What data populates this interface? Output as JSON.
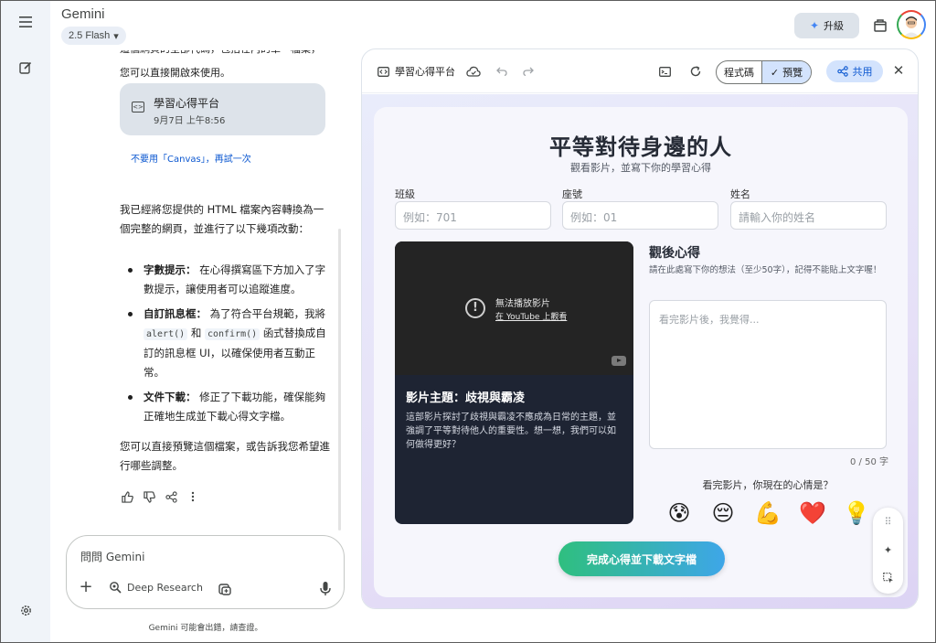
{
  "app": {
    "title": "Gemini",
    "model": "2.5 Flash"
  },
  "header": {
    "upgrade_label": "升級"
  },
  "chat": {
    "intro_lines": [
      "這個網頁的全部代碼，包括在內的單一檔案，",
      "您可以直接開啟來使用。"
    ],
    "file_card": {
      "title": "學習心得平台",
      "date": "9月7日 上午8:56"
    },
    "no_canvas_link": "不要用「Canvas」，再試一次",
    "para1": "我已經將您提供的 HTML 檔案內容轉換為一個完整的網頁，並進行了以下幾項改動：",
    "bullets": [
      {
        "bold": "字數提示：",
        "text": "在心得撰寫區下方加入了字數提示，讓使用者可以追蹤進度。"
      },
      {
        "bold": "自訂訊息框：",
        "pre": "為了符合平台規範，我將",
        "code1": "alert()",
        "mid": "和",
        "code2": "confirm()",
        "post": "函式替換成自訂的訊息框 UI，以確保使用者互動正常。"
      },
      {
        "bold": "文件下載：",
        "text": "修正了下載功能，確保能夠正確地生成並下載心得文字檔。"
      }
    ],
    "para2": "您可以直接預覽這個檔案，或告訴我您希望進行哪些調整。"
  },
  "composer": {
    "placeholder": "問問 Gemini",
    "deep_research": "Deep Research"
  },
  "disclaimer": "Gemini 可能會出錯，請查證。",
  "canvas": {
    "title": "學習心得平台",
    "code_tab": "程式碼",
    "preview_tab": "預覽",
    "share_label": "共用",
    "page": {
      "title": "平等對待身邊的人",
      "subtitle": "觀看影片，並寫下你的學習心得",
      "fields": [
        {
          "label": "班級",
          "placeholder": "例如：701"
        },
        {
          "label": "座號",
          "placeholder": "例如：01"
        },
        {
          "label": "姓名",
          "placeholder": "請輸入你的姓名"
        }
      ],
      "video": {
        "error": "無法播放影片",
        "link": "在 YouTube 上觀看",
        "topic": "影片主題：歧視與霸凌",
        "desc": "這部影片探討了歧視與霸凌不應成為日常的主題，並強調了平等對待他人的重要性。想一想，我們可以如何做得更好？"
      },
      "reflection": {
        "title": "觀後心得",
        "hint": "請在此處寫下你的想法（至少50字），記得不能貼上文字喔！",
        "placeholder": "看完影片後，我覺得...",
        "count": "0 / 50 字"
      },
      "mood_question": "看完影片，你現在的心情是？",
      "moods": [
        "😰",
        "😔",
        "💪",
        "❤️",
        "💡"
      ],
      "submit": "完成心得並下載文字檔"
    }
  }
}
